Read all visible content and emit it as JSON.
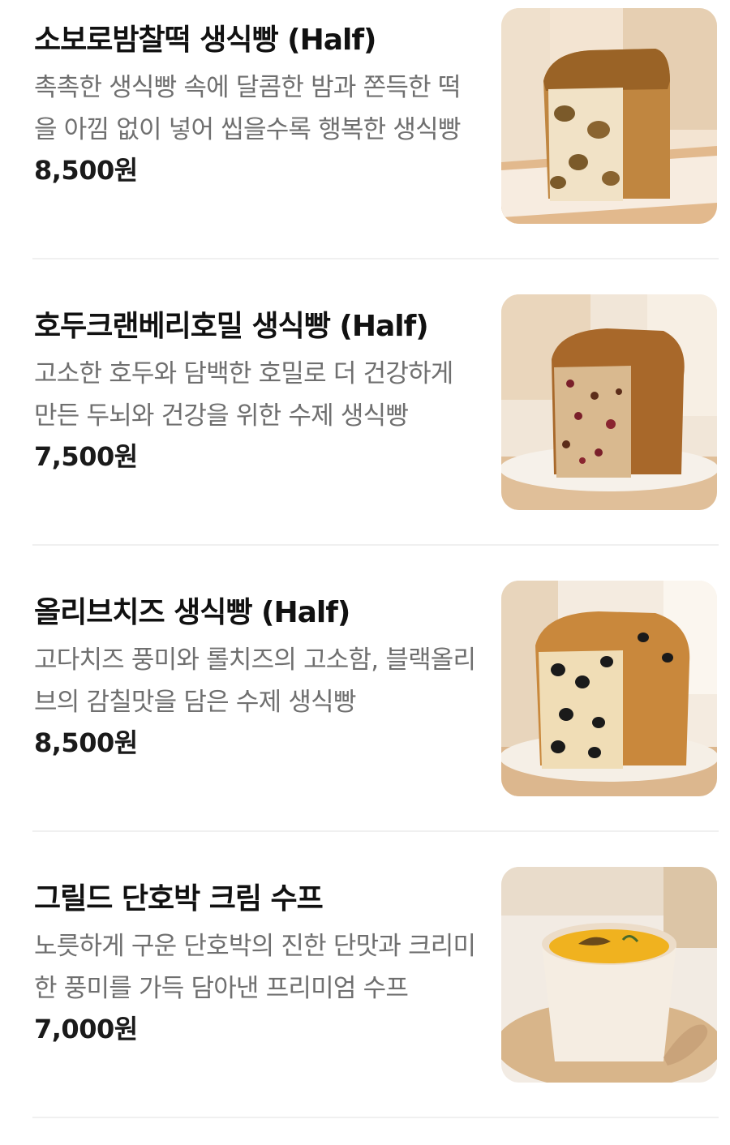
{
  "menu": {
    "items": [
      {
        "name": "소보로밤찰떡 생식빵 (Half)",
        "description": "촉촉한 생식빵 속에 달콤한 밤과 쫀득한 떡을 아낌 없이 넣어 씹을수록 행복한 생식빵",
        "price": "8,500원",
        "image_icon": "soboro-chestnut-bread-photo"
      },
      {
        "name": "호두크랜베리호밀 생식빵 (Half)",
        "description": "고소한 호두와 담백한 호밀로 더 건강하게 만든 두뇌와 건강을 위한 수제 생식빵",
        "price": "7,500원",
        "image_icon": "walnut-cranberry-rye-bread-photo"
      },
      {
        "name": "올리브치즈 생식빵 (Half)",
        "description": "고다치즈 풍미와 롤치즈의 고소함, 블랙올리브의 감칠맛을 담은 수제 생식빵",
        "price": "8,500원",
        "image_icon": "olive-cheese-bread-photo"
      },
      {
        "name": "그릴드 단호박 크림 수프",
        "description": "노릇하게 구운 단호박의 진한 단맛과 크리미한 풍미를 가득 담아낸 프리미엄 수프",
        "price": "7,000원",
        "image_icon": "pumpkin-cream-soup-photo"
      }
    ]
  }
}
